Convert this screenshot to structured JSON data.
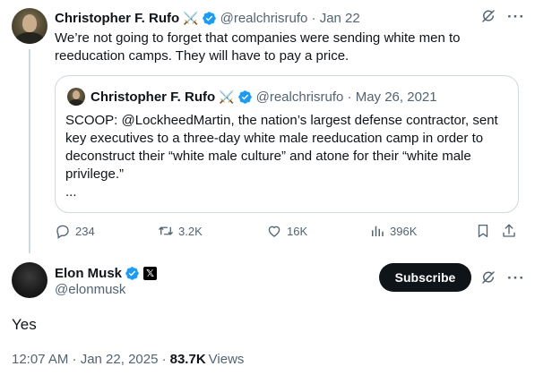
{
  "tweet": {
    "author_name": "Christopher F. Rufo",
    "author_emoji": "⚔️",
    "author_handle": "@realchrisrufo",
    "date": "Jan 22",
    "handle_date": "@realchrisrufo · Jan 22",
    "text": "We’re not going to forget that companies were sending white men to reeducation camps. They will have to pay a price.",
    "icons": [
      "grok-icon",
      "more-icon"
    ]
  },
  "quoted": {
    "author_name": "Christopher F. Rufo",
    "author_emoji": "⚔️",
    "handle_date": "@realchrisrufo · May 26, 2021",
    "text": "SCOOP: @LockheedMartin, the nation’s largest defense contractor, sent key executives to a three-day white male reeducation camp in order to deconstruct their “white male culture” and atone for their “white male privilege.”",
    "ellipsis": "..."
  },
  "actions": {
    "replies": "234",
    "reposts": "3.2K",
    "likes": "16K",
    "views": "396K",
    "icons": [
      "reply-icon",
      "repost-icon",
      "like-icon",
      "views-icon",
      "bookmark-icon",
      "share-icon"
    ]
  },
  "reply": {
    "author_name": "Elon Musk",
    "author_handle": "@elonmusk",
    "affiliate_badge": "𝕏",
    "subscribe_label": "Subscribe",
    "text": "Yes",
    "time_date": "12:07 AM · Jan 22, 2025 ·",
    "views_count": "83.7K",
    "views_label": "Views"
  },
  "colors": {
    "verified": "#1d9bf0",
    "muted": "#536471",
    "text": "#0f1419",
    "border": "#cfd9de"
  }
}
